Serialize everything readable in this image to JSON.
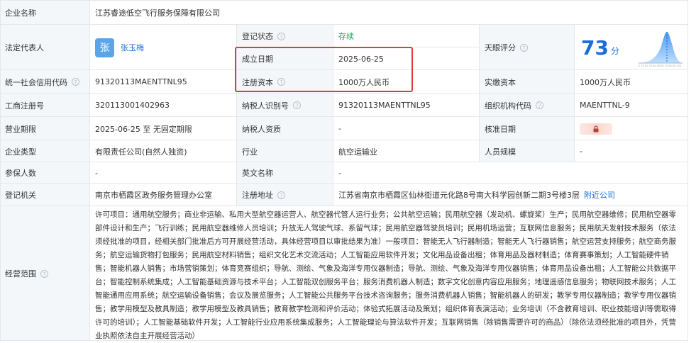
{
  "company": {
    "name_label": "企业名称",
    "name": "江苏睿途低空飞行服务保障有限公司",
    "legal_rep_label": "法定代表人",
    "legal_rep_avatar": "张",
    "legal_rep": "张玉梅",
    "status_label": "登记状态",
    "status": "存续",
    "score_label": "天眼评分",
    "score": "73",
    "score_unit": "分",
    "established_label": "成立日期",
    "established": "2025-06-25",
    "reg_capital_label": "注册资本",
    "reg_capital": "1000万人民币",
    "paid_capital_label": "实缴资本",
    "paid_capital": "1000万人民币",
    "credit_code_label": "统一社会信用代码",
    "credit_code": "91320113MAENTTNL95",
    "reg_no_label": "工商注册号",
    "reg_no": "320113001402963",
    "taxpayer_id_label": "纳税人识别号",
    "taxpayer_id": "91320113MAENTTNL95",
    "org_code_label": "组织机构代码",
    "org_code": "MAENTTNL-9",
    "term_label": "营业期限",
    "term": "2025-06-25 至 无固定期限",
    "taxpayer_qual_label": "纳税人资质",
    "taxpayer_qual": "-",
    "approval_date_label": "核准日期",
    "type_label": "企业类型",
    "type": "有限责任公司(自然人独资)",
    "industry_label": "行业",
    "industry": "航空运输业",
    "staff_size_label": "人员规模",
    "staff_size": "-",
    "insured_label": "参保人数",
    "insured": "-",
    "english_name_label": "英文名称",
    "english_name": "-",
    "authority_label": "登记机关",
    "authority": "南京市栖霞区政务服务管理办公室",
    "address_label": "注册地址",
    "address": "江苏省南京市栖霞区仙林街道元化路8号南大科学园创新二期3号楼3层",
    "nearby_link": "附近公司",
    "scope_label": "经营范围",
    "scope": "许可项目：通用航空服务；商业非运输、私用大型航空器运营人、航空器代管人运行业务；公共航空运输；民用航空器（发动机、螺旋桨）生产；民用航空器维修；民用航空器零部件设计和生产；飞行训练；民用航空器维修人员培训；升放无人驾驶气球、系留气球；民用航空器驾驶员培训；民用机场运营；互联网信息服务；民用航天发射技术服务（依法须经批准的项目，经相关部门批准后方可开展经营活动，具体经营项目以审批结果为准）一般项目：智能无人飞行器制造；智能无人飞行器销售；航空运营支持服务；航空商务服务；航空运输货物打包服务；民用航空材料销售；组织文化艺术交流活动；人工智能应用软件开发；文化用品设备出租；体育用品及器材制造；体育赛事策划；人工智能硬件销售；智能机器人销售；市场营销策划；体育竞赛组织；导航、测绘、气象及海洋专用仪器制造；导航、测绘、气象及海洋专用仪器销售；体育用品设备出租；人工智能公共数据平台；智能控制系统集成；人工智能基础资源与技术平台；人工智能双创服务平台；服务消费机器人制造；数字文化创意内容应用服务；地理遥感信息服务；物联网技术服务；人工智能通用应用系统；航空运输设备销售；会议及展览服务；人工智能公共服务平台技术咨询服务；服务消费机器人销售；智能机器人的研发；教学专用仪器制造；教学专用仪器销售；教学用模型及教具制造；教学用模型及教具销售；教育教学检测和评价活动；体验式拓展活动及策划；组织体育表演活动；业务培训（不含教育培训、职业技能培训等需取得许可的培训）；人工智能基础软件开发；人工智能行业应用系统集成服务；人工智能理论与算法软件开发；互联网销售（除销售需要许可的商品）（除依法须经批准的项目外，凭营业执照依法自主开展经营活动）"
  },
  "colors": {
    "accent": "#1a6dd8",
    "status_green": "#19a55b",
    "highlight_red": "#e53935",
    "label_bg": "#f4f7fa"
  },
  "icons": {
    "help": "help-circle-icon",
    "lock": "lock-icon",
    "score_chart": "score-distribution-chart-icon"
  }
}
